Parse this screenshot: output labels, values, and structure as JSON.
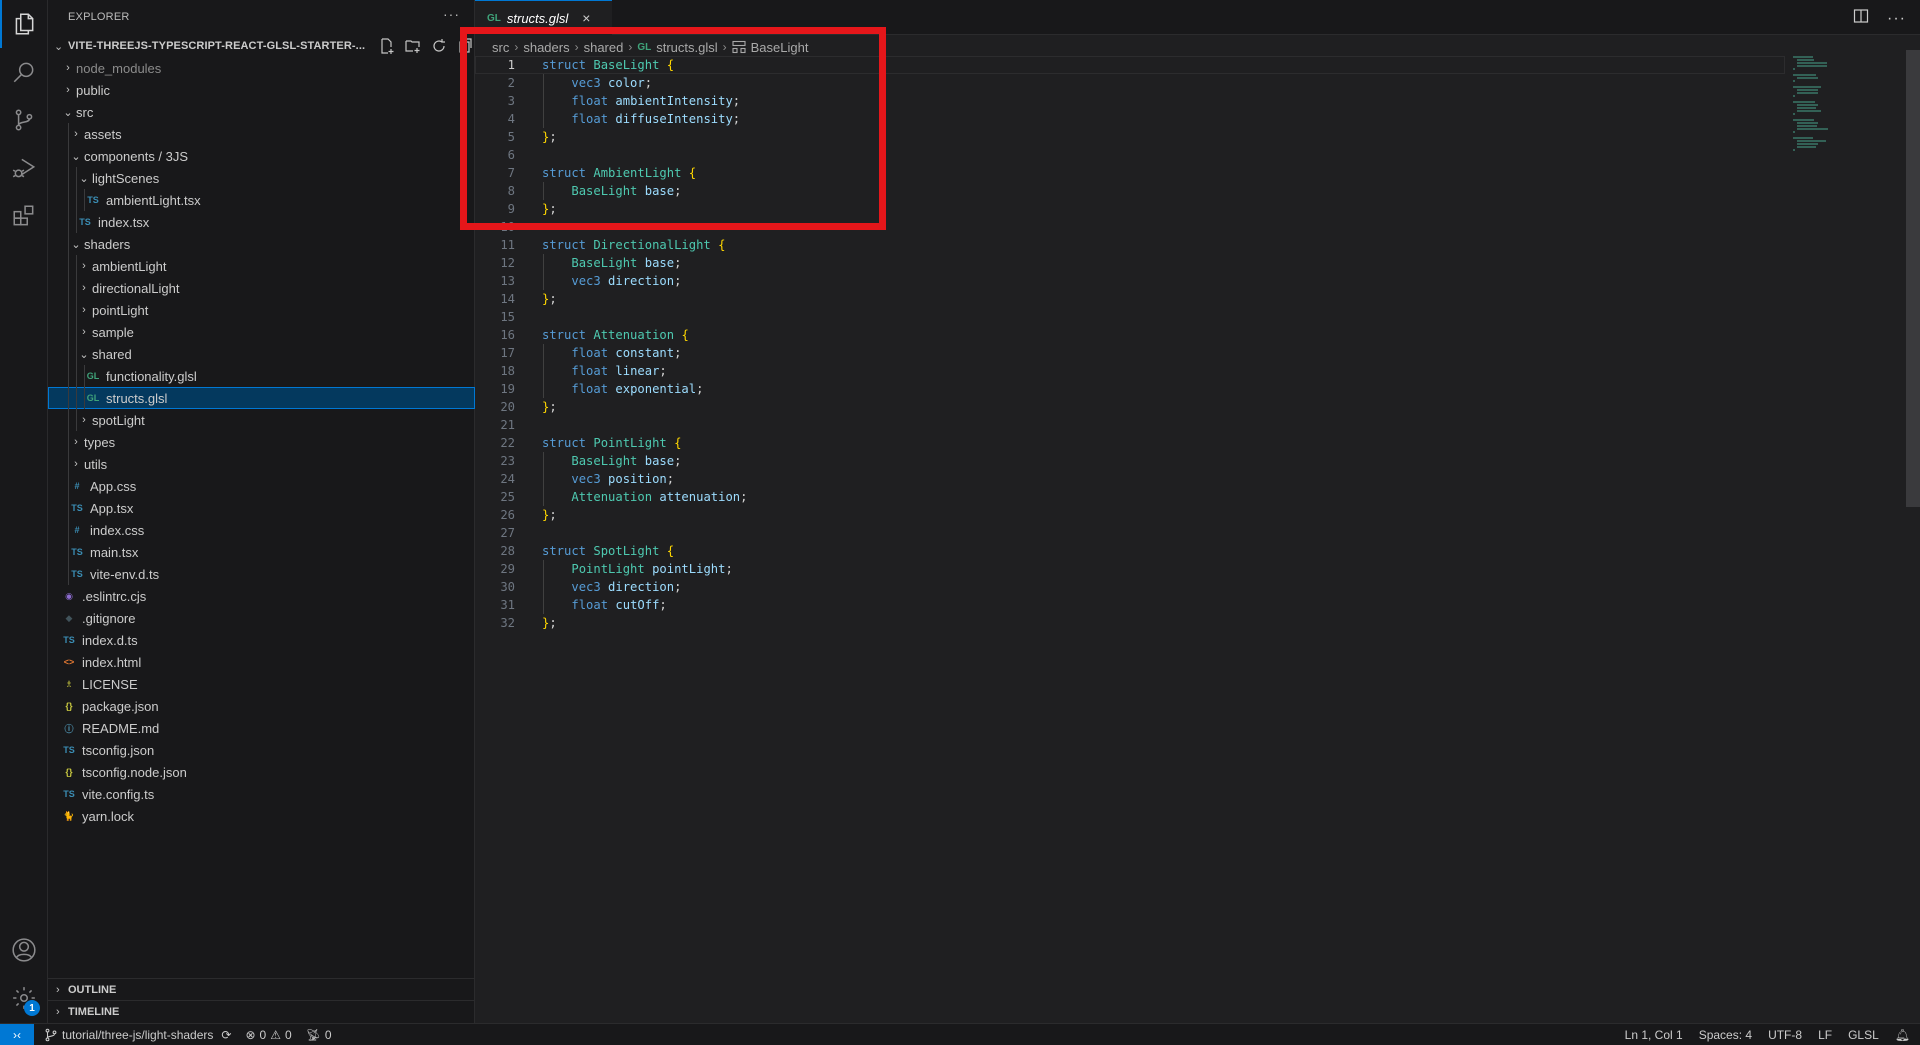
{
  "activity_bar": {
    "items": [
      {
        "name": "explorer",
        "icon": "files-icon",
        "active": true
      },
      {
        "name": "search",
        "icon": "search-icon"
      },
      {
        "name": "source-control",
        "icon": "source-control-icon"
      },
      {
        "name": "run-debug",
        "icon": "run-debug-icon"
      },
      {
        "name": "extensions",
        "icon": "extensions-icon"
      }
    ],
    "bottom": [
      {
        "name": "accounts",
        "icon": "account-icon"
      },
      {
        "name": "manage",
        "icon": "gear-icon",
        "badge": "1"
      }
    ]
  },
  "sidebar": {
    "title": "EXPLORER",
    "more": "···",
    "root": "VITE-THREEJS-TYPESCRIPT-REACT-GLSL-STARTER-...",
    "tree": [
      {
        "label": "node_modules",
        "depth": 1,
        "type": "folder",
        "open": false,
        "dim": true
      },
      {
        "label": "public",
        "depth": 1,
        "type": "folder",
        "open": false
      },
      {
        "label": "src",
        "depth": 1,
        "type": "folder",
        "open": true
      },
      {
        "label": "assets",
        "depth": 2,
        "type": "folder",
        "open": false
      },
      {
        "label": "components / 3JS",
        "depth": 2,
        "type": "folder",
        "open": true
      },
      {
        "label": "lightScenes",
        "depth": 3,
        "type": "folder",
        "open": true
      },
      {
        "label": "ambientLight.tsx",
        "depth": 4,
        "type": "file",
        "icon": "TS",
        "color": "#3b8eb5"
      },
      {
        "label": "index.tsx",
        "depth": 3,
        "type": "file",
        "icon": "TS",
        "color": "#3b8eb5"
      },
      {
        "label": "shaders",
        "depth": 2,
        "type": "folder",
        "open": true
      },
      {
        "label": "ambientLight",
        "depth": 3,
        "type": "folder",
        "open": false
      },
      {
        "label": "directionalLight",
        "depth": 3,
        "type": "folder",
        "open": false
      },
      {
        "label": "pointLight",
        "depth": 3,
        "type": "folder",
        "open": false
      },
      {
        "label": "sample",
        "depth": 3,
        "type": "folder",
        "open": false
      },
      {
        "label": "shared",
        "depth": 3,
        "type": "folder",
        "open": true
      },
      {
        "label": "functionality.glsl",
        "depth": 4,
        "type": "file",
        "icon": "GL",
        "color": "#3fa37a"
      },
      {
        "label": "structs.glsl",
        "depth": 4,
        "type": "file",
        "icon": "GL",
        "color": "#3fa37a",
        "selected": true
      },
      {
        "label": "spotLight",
        "depth": 3,
        "type": "folder",
        "open": false
      },
      {
        "label": "types",
        "depth": 2,
        "type": "folder",
        "open": false
      },
      {
        "label": "utils",
        "depth": 2,
        "type": "folder",
        "open": false
      },
      {
        "label": "App.css",
        "depth": 2,
        "type": "file",
        "icon": "#",
        "color": "#3b8eb5"
      },
      {
        "label": "App.tsx",
        "depth": 2,
        "type": "file",
        "icon": "TS",
        "color": "#3b8eb5"
      },
      {
        "label": "index.css",
        "depth": 2,
        "type": "file",
        "icon": "#",
        "color": "#3b8eb5"
      },
      {
        "label": "main.tsx",
        "depth": 2,
        "type": "file",
        "icon": "TS",
        "color": "#3b8eb5"
      },
      {
        "label": "vite-env.d.ts",
        "depth": 2,
        "type": "file",
        "icon": "TS",
        "color": "#3b8eb5"
      },
      {
        "label": ".eslintrc.cjs",
        "depth": 1,
        "type": "file",
        "icon": "◉",
        "color": "#8d6cd1"
      },
      {
        "label": ".gitignore",
        "depth": 1,
        "type": "file",
        "icon": "◆",
        "color": "#41535b"
      },
      {
        "label": "index.d.ts",
        "depth": 1,
        "type": "file",
        "icon": "TS",
        "color": "#3b8eb5"
      },
      {
        "label": "index.html",
        "depth": 1,
        "type": "file",
        "icon": "<>",
        "color": "#e37933"
      },
      {
        "label": "LICENSE",
        "depth": 1,
        "type": "file",
        "icon": "♗",
        "color": "#cbcb41"
      },
      {
        "label": "package.json",
        "depth": 1,
        "type": "file",
        "icon": "{}",
        "color": "#cbcb41"
      },
      {
        "label": "README.md",
        "depth": 1,
        "type": "file",
        "icon": "ⓘ",
        "color": "#519aba"
      },
      {
        "label": "tsconfig.json",
        "depth": 1,
        "type": "file",
        "icon": "TS",
        "color": "#3b8eb5"
      },
      {
        "label": "tsconfig.node.json",
        "depth": 1,
        "type": "file",
        "icon": "{}",
        "color": "#cbcb41"
      },
      {
        "label": "vite.config.ts",
        "depth": 1,
        "type": "file",
        "icon": "TS",
        "color": "#3b8eb5"
      },
      {
        "label": "yarn.lock",
        "depth": 1,
        "type": "file",
        "icon": "🐈",
        "color": "#2188b6"
      }
    ],
    "panels": [
      "OUTLINE",
      "TIMELINE"
    ]
  },
  "editor": {
    "tab": {
      "icon": "GL",
      "name": "structs.glsl",
      "close": "×"
    },
    "breadcrumb": [
      "src",
      "shaders",
      "shared",
      "structs.glsl",
      "BaseLight"
    ],
    "breadcrumb_file_icon": "GL",
    "current_line": 1,
    "lines": [
      [
        [
          "kw",
          "struct "
        ],
        [
          "ty",
          "BaseLight "
        ],
        [
          "br",
          "{"
        ]
      ],
      [
        [
          "pu",
          "    "
        ],
        [
          "kw",
          "vec3 "
        ],
        [
          "id",
          "color"
        ],
        [
          "pu",
          ";"
        ]
      ],
      [
        [
          "pu",
          "    "
        ],
        [
          "kw",
          "float "
        ],
        [
          "id",
          "ambientIntensity"
        ],
        [
          "pu",
          ";"
        ]
      ],
      [
        [
          "pu",
          "    "
        ],
        [
          "kw",
          "float "
        ],
        [
          "id",
          "diffuseIntensity"
        ],
        [
          "pu",
          ";"
        ]
      ],
      [
        [
          "br",
          "}"
        ],
        [
          "pu",
          ";"
        ]
      ],
      [],
      [
        [
          "kw",
          "struct "
        ],
        [
          "ty",
          "AmbientLight "
        ],
        [
          "br",
          "{"
        ]
      ],
      [
        [
          "pu",
          "    "
        ],
        [
          "ty",
          "BaseLight "
        ],
        [
          "id",
          "base"
        ],
        [
          "pu",
          ";"
        ]
      ],
      [
        [
          "br",
          "}"
        ],
        [
          "pu",
          ";"
        ]
      ],
      [],
      [
        [
          "kw",
          "struct "
        ],
        [
          "ty",
          "DirectionalLight "
        ],
        [
          "br",
          "{"
        ]
      ],
      [
        [
          "pu",
          "    "
        ],
        [
          "ty",
          "BaseLight "
        ],
        [
          "id",
          "base"
        ],
        [
          "pu",
          ";"
        ]
      ],
      [
        [
          "pu",
          "    "
        ],
        [
          "kw",
          "vec3 "
        ],
        [
          "id",
          "direction"
        ],
        [
          "pu",
          ";"
        ]
      ],
      [
        [
          "br",
          "}"
        ],
        [
          "pu",
          ";"
        ]
      ],
      [],
      [
        [
          "kw",
          "struct "
        ],
        [
          "ty",
          "Attenuation "
        ],
        [
          "br",
          "{"
        ]
      ],
      [
        [
          "pu",
          "    "
        ],
        [
          "kw",
          "float "
        ],
        [
          "id",
          "constant"
        ],
        [
          "pu",
          ";"
        ]
      ],
      [
        [
          "pu",
          "    "
        ],
        [
          "kw",
          "float "
        ],
        [
          "id",
          "linear"
        ],
        [
          "pu",
          ";"
        ]
      ],
      [
        [
          "pu",
          "    "
        ],
        [
          "kw",
          "float "
        ],
        [
          "id",
          "exponential"
        ],
        [
          "pu",
          ";"
        ]
      ],
      [
        [
          "br",
          "}"
        ],
        [
          "pu",
          ";"
        ]
      ],
      [],
      [
        [
          "kw",
          "struct "
        ],
        [
          "ty",
          "PointLight "
        ],
        [
          "br",
          "{"
        ]
      ],
      [
        [
          "pu",
          "    "
        ],
        [
          "ty",
          "BaseLight "
        ],
        [
          "id",
          "base"
        ],
        [
          "pu",
          ";"
        ]
      ],
      [
        [
          "pu",
          "    "
        ],
        [
          "kw",
          "vec3 "
        ],
        [
          "id",
          "position"
        ],
        [
          "pu",
          ";"
        ]
      ],
      [
        [
          "pu",
          "    "
        ],
        [
          "ty",
          "Attenuation "
        ],
        [
          "id",
          "attenuation"
        ],
        [
          "pu",
          ";"
        ]
      ],
      [
        [
          "br",
          "}"
        ],
        [
          "pu",
          ";"
        ]
      ],
      [],
      [
        [
          "kw",
          "struct "
        ],
        [
          "ty",
          "SpotLight "
        ],
        [
          "br",
          "{"
        ]
      ],
      [
        [
          "pu",
          "    "
        ],
        [
          "ty",
          "PointLight "
        ],
        [
          "id",
          "pointLight"
        ],
        [
          "pu",
          ";"
        ]
      ],
      [
        [
          "pu",
          "    "
        ],
        [
          "kw",
          "vec3 "
        ],
        [
          "id",
          "direction"
        ],
        [
          "pu",
          ";"
        ]
      ],
      [
        [
          "pu",
          "    "
        ],
        [
          "kw",
          "float "
        ],
        [
          "id",
          "cutOff"
        ],
        [
          "pu",
          ";"
        ]
      ],
      [
        [
          "br",
          "}"
        ],
        [
          "pu",
          ";"
        ]
      ]
    ],
    "highlight_color": "#e5161a"
  },
  "status_bar": {
    "branch": "tutorial/three-js/light-shaders",
    "errors": "0",
    "warnings": "0",
    "ports": "0",
    "cursor": "Ln 1, Col 1",
    "indent": "Spaces: 4",
    "encoding": "UTF-8",
    "eol": "LF",
    "language": "GLSL"
  }
}
